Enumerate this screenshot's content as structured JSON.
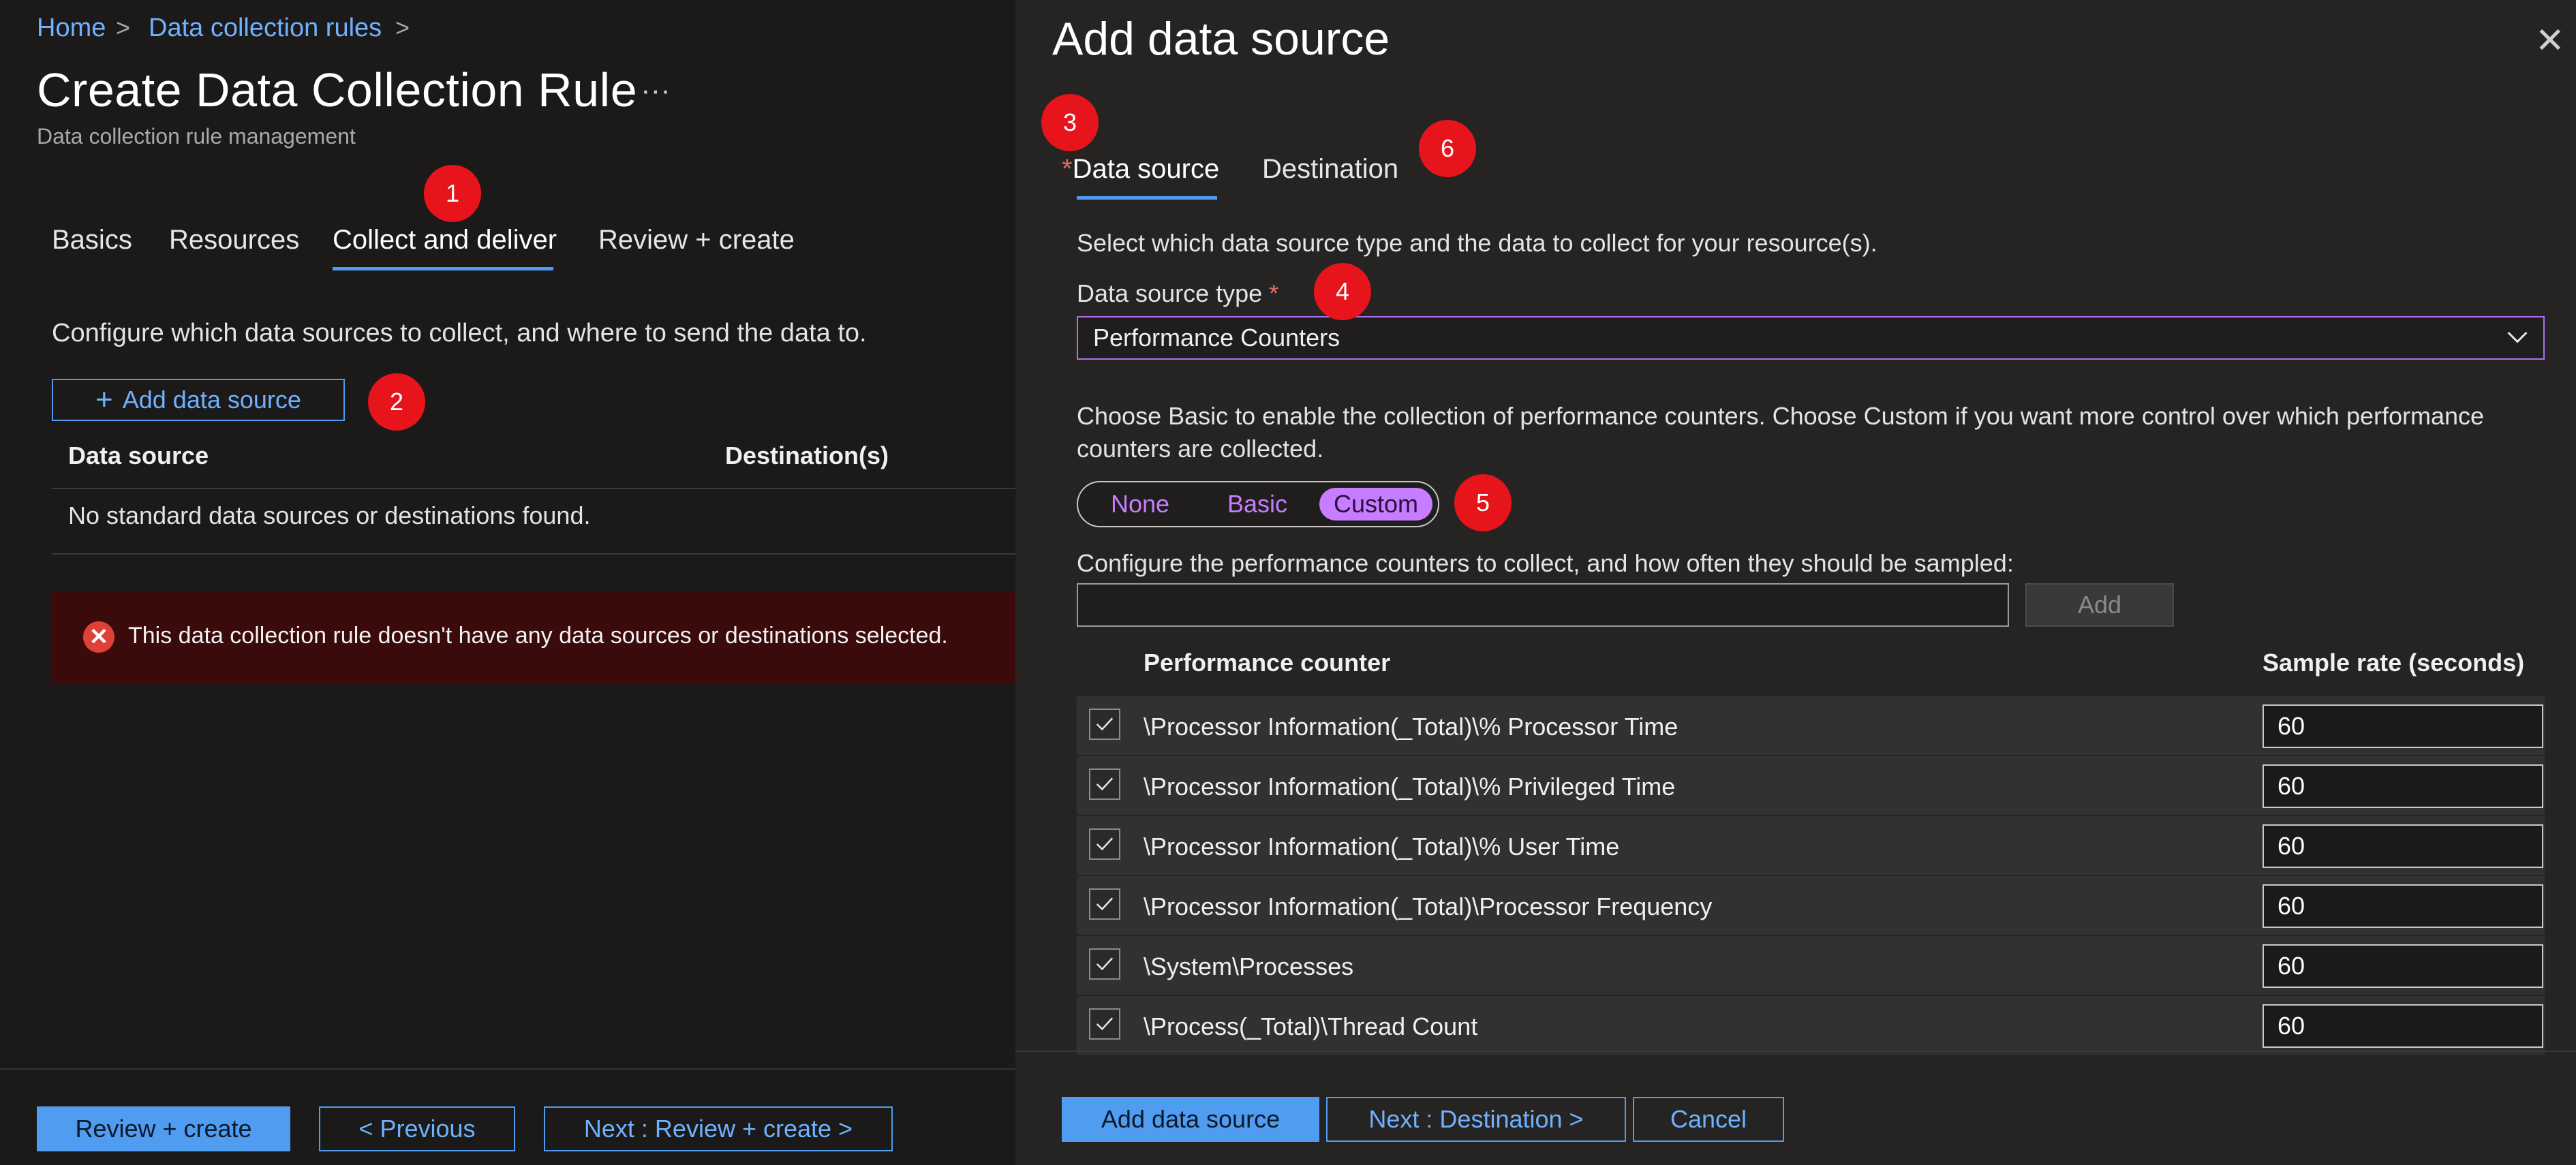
{
  "breadcrumb": {
    "home": "Home",
    "rules": "Data collection rules",
    "sep": ">"
  },
  "header": {
    "title": "Create Data Collection Rule",
    "more": "···",
    "subtitle": "Data collection rule management"
  },
  "tabs": [
    "Basics",
    "Resources",
    "Collect and deliver",
    "Review + create"
  ],
  "collect": {
    "description": "Configure which data sources to collect, and where to send the data to.",
    "add_button": "Add data source",
    "add_plus": "+",
    "col_source": "Data source",
    "col_destination": "Destination(s)",
    "empty": "No standard data sources or destinations found.",
    "error_icon": "✕",
    "error": "This data collection rule doesn't have any data sources or destinations selected."
  },
  "left_footer": {
    "review": "Review + create",
    "previous": "< Previous",
    "next": "Next : Review + create >"
  },
  "panel": {
    "title": "Add data source",
    "close": "✕",
    "tab_source": "Data source",
    "tab_source_req": "*",
    "tab_destination": "Destination",
    "intro": "Select which data source type and the data to collect for your resource(s).",
    "type_label": "Data source type",
    "type_req": "*",
    "type_value": "Performance Counters",
    "basic_custom_help_1": "Choose Basic to enable the collection of performance counters. Choose Custom if you want more control over which performance",
    "basic_custom_help_2": "counters are collected.",
    "mode_options": [
      "None",
      "Basic",
      "Custom"
    ],
    "mode_selected": "Custom",
    "configure_text": "Configure the performance counters to collect, and how often they should be sampled:",
    "add_counter": "Add",
    "col_counter": "Performance counter",
    "col_rate": "Sample rate (seconds)",
    "counters": [
      {
        "name": "\\Processor Information(_Total)\\% Processor Time",
        "rate": "60",
        "checked": true
      },
      {
        "name": "\\Processor Information(_Total)\\% Privileged Time",
        "rate": "60",
        "checked": true
      },
      {
        "name": "\\Processor Information(_Total)\\% User Time",
        "rate": "60",
        "checked": true
      },
      {
        "name": "\\Processor Information(_Total)\\Processor Frequency",
        "rate": "60",
        "checked": true
      },
      {
        "name": "\\System\\Processes",
        "rate": "60",
        "checked": true
      },
      {
        "name": "\\Process(_Total)\\Thread Count",
        "rate": "60",
        "checked": true
      }
    ],
    "footer": {
      "add": "Add data source",
      "next": "Next : Destination >",
      "cancel": "Cancel"
    }
  },
  "markers": [
    "1",
    "2",
    "3",
    "4",
    "5",
    "6"
  ],
  "colors": {
    "accent": "#4f9cf0",
    "custom_toggle": "#c77dff",
    "marker": "#e8141c",
    "error_bg": "#3b0a0a"
  }
}
